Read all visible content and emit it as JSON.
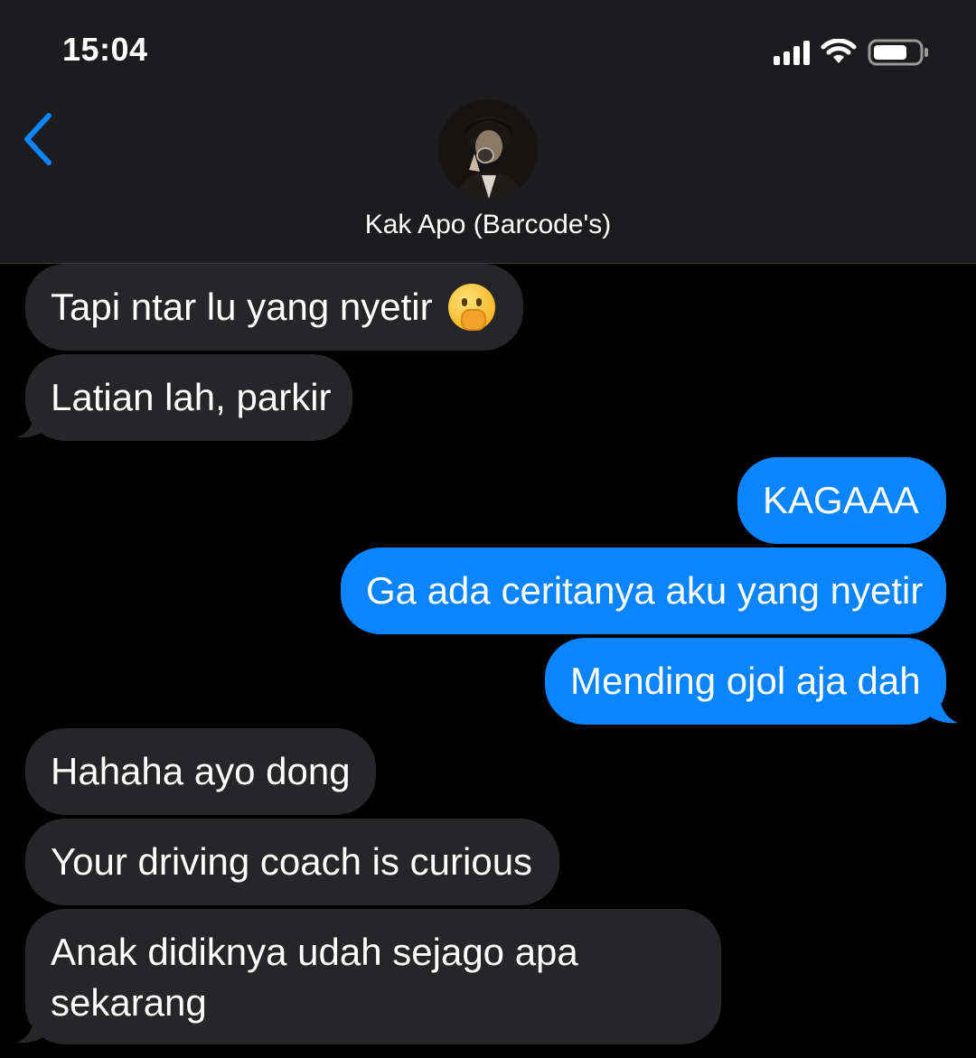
{
  "status_bar": {
    "time": "15:04"
  },
  "header": {
    "contact_name": "Kak Apo (Barcode's)"
  },
  "icons": {
    "back": "chevron-left-icon",
    "signal": "cellular-signal-icon",
    "wifi": "wifi-icon",
    "battery": "battery-icon",
    "emoji": "face-with-hand-over-mouth-emoji"
  },
  "colors": {
    "incoming_bubble": "#262628",
    "outgoing_bubble": "#0a84ff",
    "accent": "#0a84ff"
  },
  "messages": [
    {
      "direction": "incoming",
      "text": "Tapi ntar lu yang nyetir"
    },
    {
      "direction": "incoming",
      "text": "Latian lah, parkir"
    },
    {
      "direction": "outgoing",
      "text": "KAGAAA"
    },
    {
      "direction": "outgoing",
      "text": "Ga ada ceritanya aku yang nyetir"
    },
    {
      "direction": "outgoing",
      "text": "Mending ojol aja dah"
    },
    {
      "direction": "incoming",
      "text": "Hahaha ayo dong"
    },
    {
      "direction": "incoming",
      "text": "Your driving coach is curious"
    },
    {
      "direction": "incoming",
      "text": "Anak didiknya udah sejago apa sekarang"
    }
  ]
}
